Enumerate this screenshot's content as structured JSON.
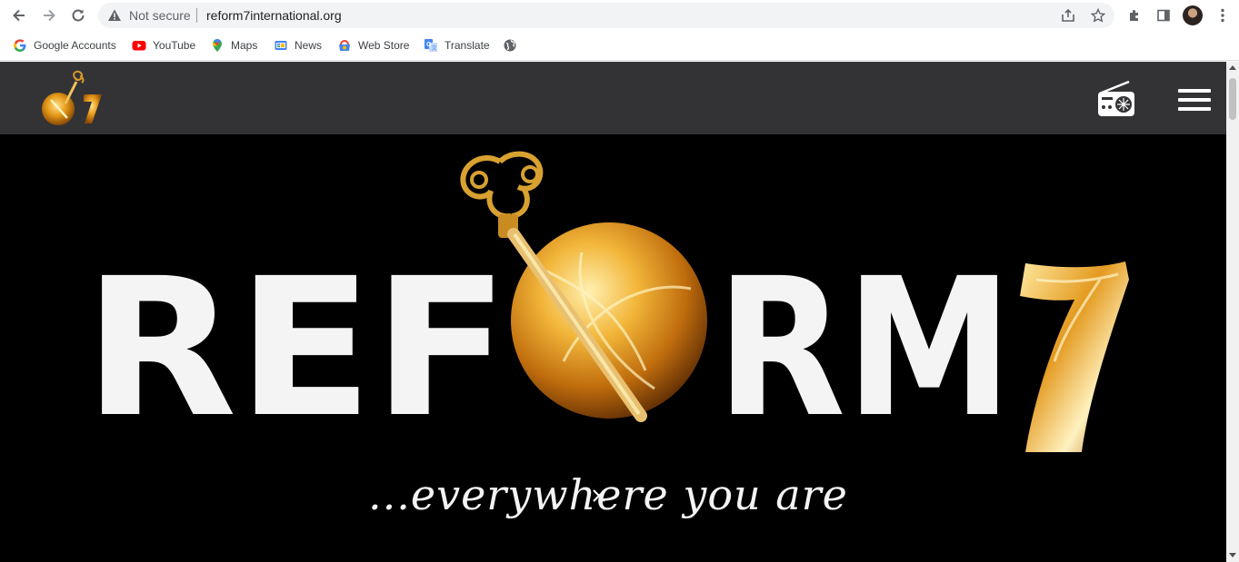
{
  "browser": {
    "security_label": "Not secure",
    "url": "reform7international.org"
  },
  "bookmarks": [
    {
      "label": "Google Accounts",
      "icon": "google-icon"
    },
    {
      "label": "YouTube",
      "icon": "youtube-icon"
    },
    {
      "label": "Maps",
      "icon": "maps-icon"
    },
    {
      "label": "News",
      "icon": "news-icon"
    },
    {
      "label": "Web Store",
      "icon": "webstore-icon"
    },
    {
      "label": "Translate",
      "icon": "translate-icon"
    },
    {
      "label": "",
      "icon": "globe-icon"
    }
  ],
  "site": {
    "logo_text": "7",
    "hero_brand": "REFORM7",
    "hero_brand_left": "REF",
    "hero_brand_right": "RM",
    "hero_brand_seven": "7",
    "tagline": "...everywhere you are"
  },
  "colors": {
    "site_header": "#333335",
    "hero_bg": "#000000",
    "gold": "#e6a21c",
    "brand_white": "#f4f4f4"
  }
}
